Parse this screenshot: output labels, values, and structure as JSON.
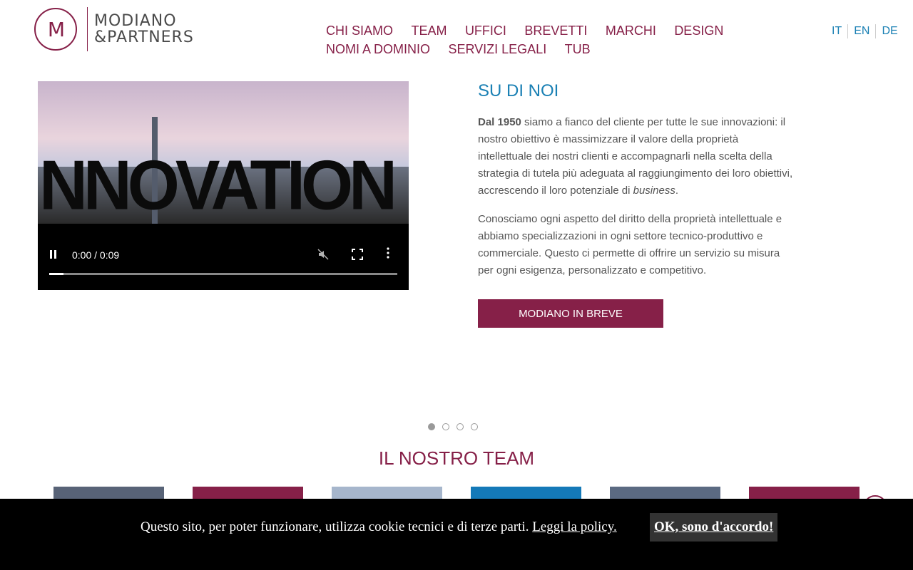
{
  "brand": {
    "mark": "M",
    "line1": "MODIANO",
    "line2": "&PARTNERS"
  },
  "nav": {
    "items": [
      {
        "label": "CHI SIAMO"
      },
      {
        "label": "TEAM"
      },
      {
        "label": "UFFICI"
      },
      {
        "label": "BREVETTI"
      },
      {
        "label": "MARCHI"
      },
      {
        "label": "DESIGN"
      },
      {
        "label": "NOMI A DOMINIO"
      },
      {
        "label": "SERVIZI LEGALI"
      },
      {
        "label": "TUB"
      }
    ]
  },
  "languages": [
    "IT",
    "EN",
    "DE"
  ],
  "video": {
    "word": "NNOVATION",
    "time": "0:00 / 0:09",
    "progress": 0.04
  },
  "about": {
    "title": "SU DI NOI",
    "p1_bold": "Dal 1950",
    "p1_rest": " siamo a fianco del cliente per tutte le sue innovazioni: il nostro obiettivo è massimizzare il valore della proprietà intellettuale dei nostri clienti e accompagnarli nella scelta della strategia di tutela più adeguata al raggiungimento dei loro obiettivi, accrescendo il loro potenziale di ",
    "p1_italic": "business",
    "p1_end": ".",
    "p2": "Conosciamo ogni aspetto del diritto della proprietà intellettuale e abbiamo specializzazioni in ogni settore tecnico-produttivo e commerciale. Questo ci permette di offrire un servizio su misura per ogni esigenza, personalizzato e competitivo.",
    "cta": "MODIANO IN BREVE"
  },
  "carousel": {
    "count": 4,
    "active": 0
  },
  "team": {
    "title": "IL NOSTRO TEAM",
    "card_colors": [
      "#586377",
      "#862048",
      "#a6b6cc",
      "#1479b8",
      "#5b6a82",
      "#862048"
    ]
  },
  "cookie": {
    "text": "Questo sito, per poter funzionare, utilizza cookie tecnici e di terze parti. ",
    "link": "Leggi la policy.",
    "button": "OK, sono d'accordo!"
  },
  "colors": {
    "brand": "#862048",
    "accent": "#1a80b4"
  }
}
